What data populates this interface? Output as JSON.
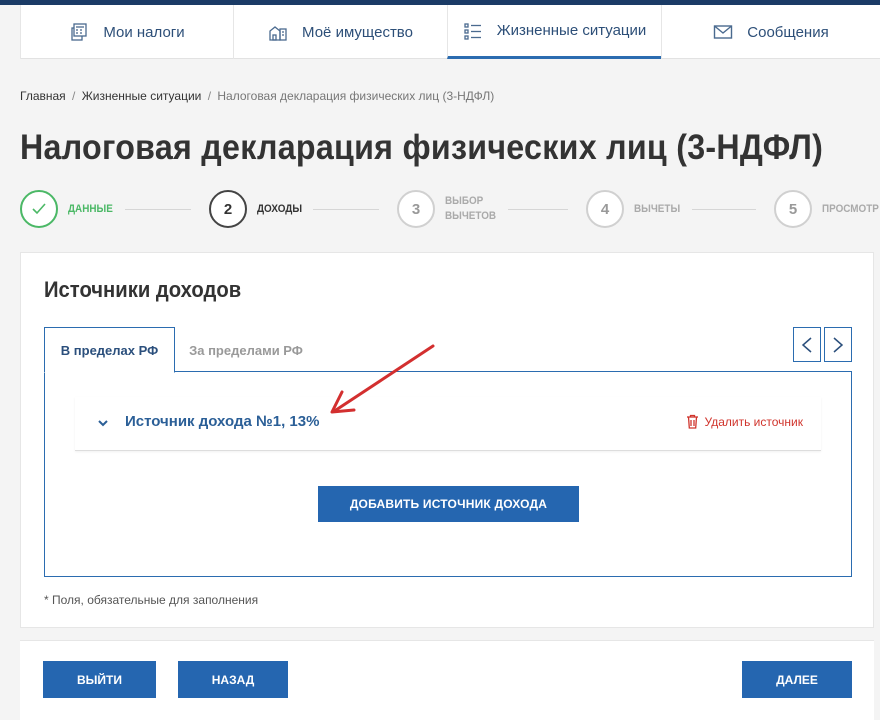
{
  "nav": {
    "items": [
      {
        "label": "Мои налоги",
        "icon": "calculator-icon"
      },
      {
        "label": "Моё имущество",
        "icon": "property-icon"
      },
      {
        "label": "Жизненные ситуации",
        "icon": "list-icon"
      },
      {
        "label": "Сообщения",
        "icon": "envelope-icon"
      }
    ],
    "active_index": 2
  },
  "breadcrumb": {
    "items": [
      "Главная",
      "Жизненные ситуации",
      "Налоговая декларация физических лиц (3-НДФЛ)"
    ],
    "separator": "/"
  },
  "page_title": "Налоговая декларация физических лиц (3-НДФЛ)",
  "steps": [
    {
      "number": "",
      "label": "ДАННЫЕ",
      "state": "done"
    },
    {
      "number": "2",
      "label": "ДОХОДЫ",
      "state": "current"
    },
    {
      "number": "3",
      "label_line1": "ВЫБОР",
      "label_line2": "ВЫЧЕТОВ",
      "state": "pending"
    },
    {
      "number": "4",
      "label": "ВЫЧЕТЫ",
      "state": "pending"
    },
    {
      "number": "5",
      "label": "ПРОСМОТР",
      "state": "pending"
    }
  ],
  "income_sources": {
    "title": "Источники доходов",
    "tabs": [
      {
        "label": "В пределах РФ",
        "active": true
      },
      {
        "label": "За пределами РФ",
        "active": false
      }
    ],
    "sources": [
      {
        "title": "Источник дохода №1, 13%",
        "delete_label": "Удалить источник"
      }
    ],
    "add_button_label": "ДОБАВИТЬ ИСТОЧНИК ДОХОДА",
    "required_note": "* Поля, обязательные для заполнения"
  },
  "actions": {
    "exit_label": "ВЫЙТИ",
    "back_label": "НАЗАД",
    "next_label": "ДАЛЕЕ"
  },
  "colors": {
    "primary": "#2566b0",
    "link": "#2b5f97",
    "success": "#4bb866",
    "danger": "#d0342c",
    "annotation": "#d32f2f"
  }
}
